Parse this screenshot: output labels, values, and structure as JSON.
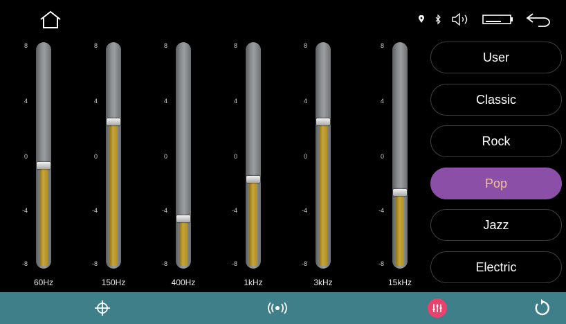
{
  "colors": {
    "accent_active": "#8b4fa8",
    "bottom_bar": "#3f7f89",
    "fill_gold": "#c9a537"
  },
  "top_bar": {
    "home_icon": "home-icon",
    "status_icons": [
      "location-icon",
      "bluetooth-icon",
      "volume-icon",
      "battery-icon",
      "back-arrow-icon"
    ]
  },
  "equalizer": {
    "scale_labels": [
      "8",
      "4",
      "0",
      "-4",
      "-8"
    ],
    "range": [
      -8,
      8
    ],
    "bands": [
      {
        "label": "60Hz",
        "value": -0.6
      },
      {
        "label": "150Hz",
        "value": 2.7
      },
      {
        "label": "400Hz",
        "value": -4.6
      },
      {
        "label": "1kHz",
        "value": -1.6
      },
      {
        "label": "3kHz",
        "value": 2.7
      },
      {
        "label": "15kHz",
        "value": -2.6
      }
    ]
  },
  "presets": {
    "items": [
      "User",
      "Classic",
      "Rock",
      "Pop",
      "Jazz",
      "Electric"
    ],
    "selected": "Pop"
  },
  "bottom_bar": {
    "icons": [
      "balance-crosshair-icon",
      "surround-sound-icon",
      "equalizer-icon",
      "reset-icon"
    ],
    "active": "equalizer-icon"
  }
}
